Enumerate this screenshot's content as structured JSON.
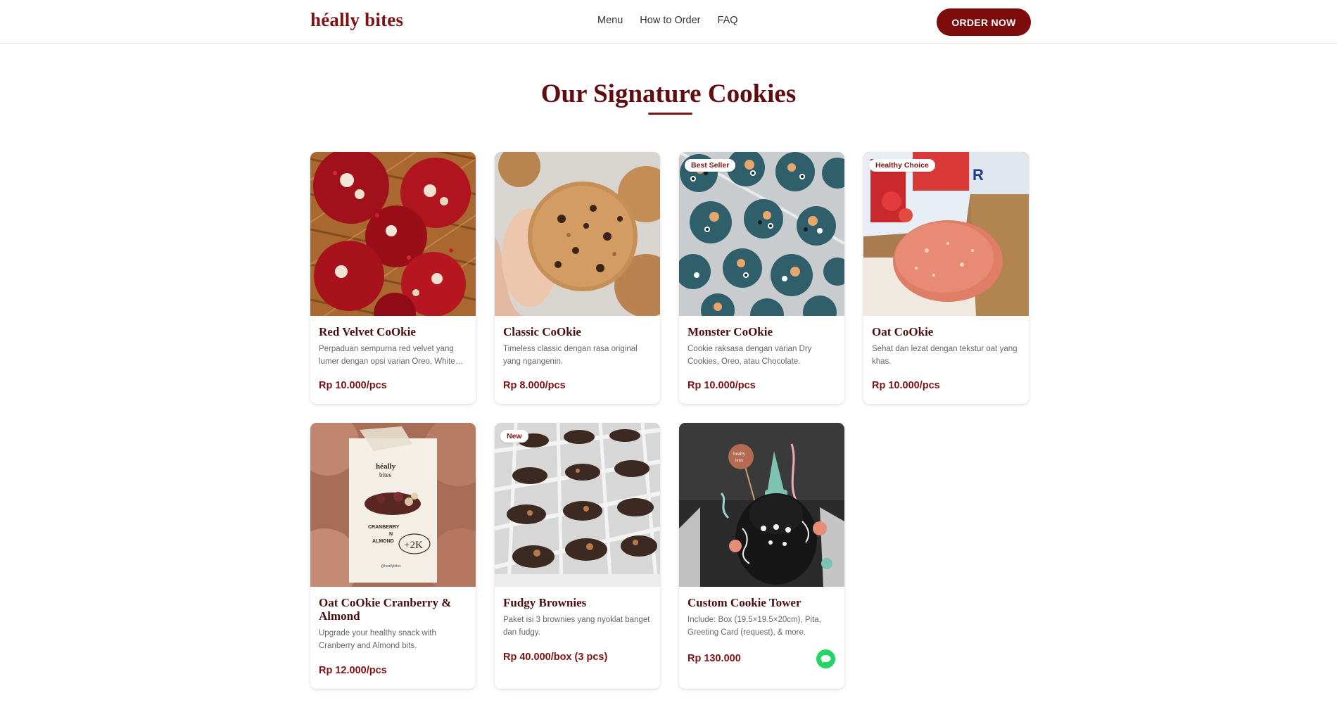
{
  "header": {
    "logo": "héally bites",
    "nav": [
      "Menu",
      "How to Order",
      "FAQ"
    ],
    "cta": "ORDER NOW"
  },
  "section": {
    "title": "Our Signature Cookies"
  },
  "products": [
    {
      "name": "Red Velvet CoOkie",
      "description": "Perpaduan sempurna red velvet yang lumer dengan opsi varian Oreo, White Chocolate, atau Cream Cheese.",
      "price": "Rp 10.000/pcs",
      "badge": ""
    },
    {
      "name": "Classic CoOkie",
      "description": "Timeless classic dengan rasa original yang ngangenin.",
      "price": "Rp 8.000/pcs",
      "badge": ""
    },
    {
      "name": "Monster CoOkie",
      "description": "Cookie raksasa dengan varian Dry Cookies, Oreo, atau Chocolate.",
      "price": "Rp 10.000/pcs",
      "badge": "Best Seller"
    },
    {
      "name": "Oat CoOkie",
      "description": "Sehat dan lezat dengan tekstur oat yang khas.",
      "price": "Rp 10.000/pcs",
      "badge": "Healthy Choice"
    },
    {
      "name": "Oat CoOkie Cranberry & Almond",
      "description": "Upgrade your healthy snack with Cranberry and Almond bits.",
      "price": "Rp 12.000/pcs",
      "badge": ""
    },
    {
      "name": "Fudgy Brownies",
      "description": "Paket isi 3 brownies yang nyoklat banget dan fudgy.",
      "price": "Rp 40.000/box (3 pcs)",
      "badge": "New"
    },
    {
      "name": "Custom Cookie Tower",
      "description": "Include: Box (19.5×19.5×20cm), Pita, Greeting Card (request), & more.",
      "price": "Rp 130.000",
      "badge": ""
    }
  ],
  "icons": {
    "chat": "chat-bubble-icon"
  },
  "colors": {
    "brand": "#7c1416",
    "cta": "#7c0b0c",
    "whatsapp": "#25d366"
  }
}
